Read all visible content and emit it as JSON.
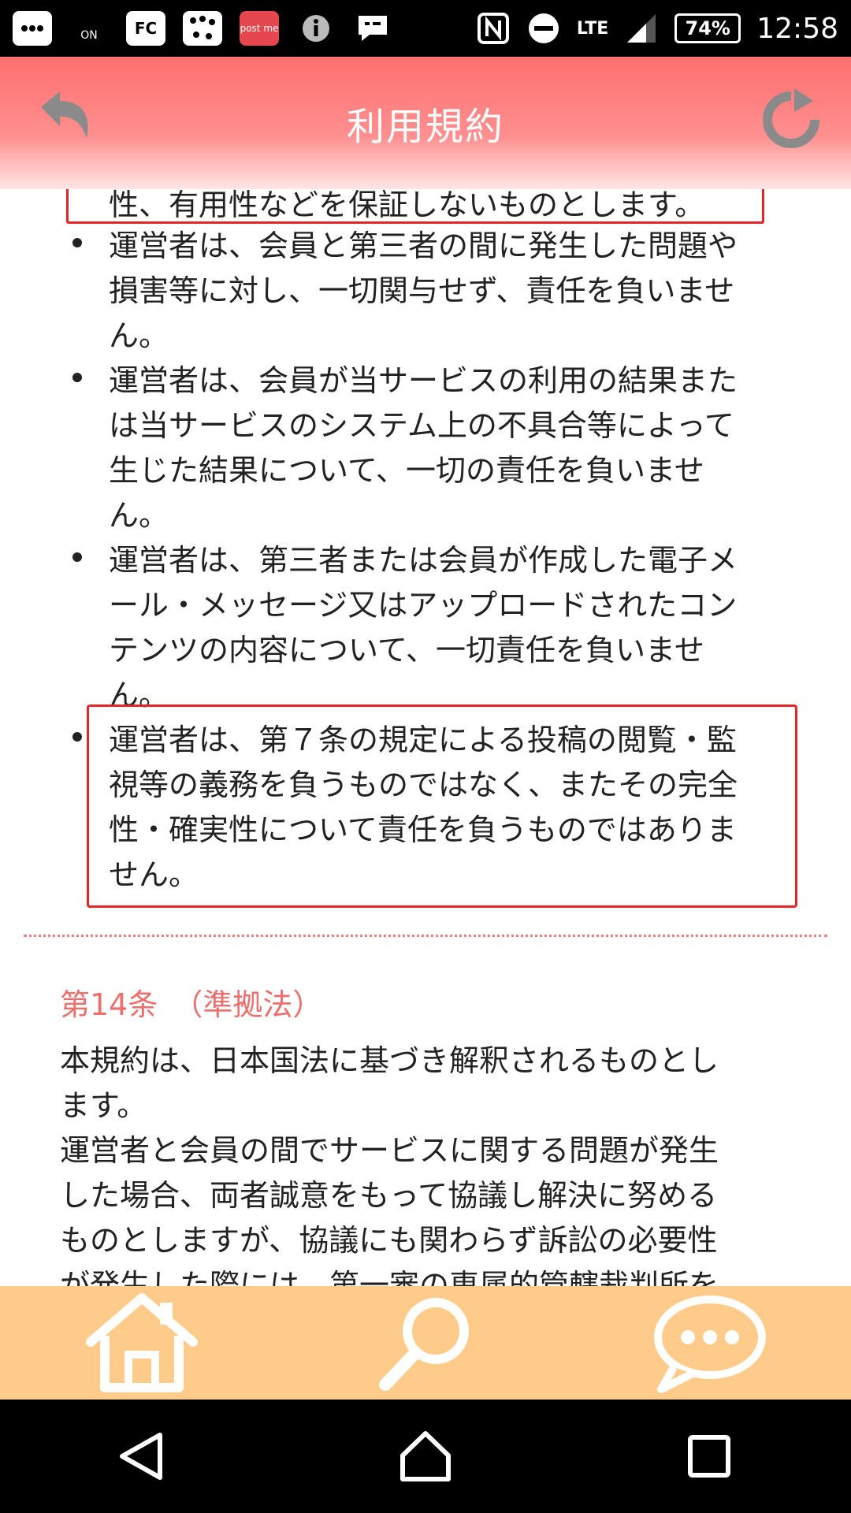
{
  "status_bar": {
    "icons": [
      {
        "name": "message-dots-icon",
        "label": ""
      },
      {
        "name": "wifi-call-icon",
        "label": "ON"
      },
      {
        "name": "fc-app-icon",
        "label": "FC"
      },
      {
        "name": "connect-app-icon",
        "label": ""
      },
      {
        "name": "postme-app-icon",
        "label": "post me"
      },
      {
        "name": "info-icon",
        "label": ""
      },
      {
        "name": "chat-bubble-icon",
        "label": ""
      }
    ],
    "network": "LTE",
    "battery": "74%",
    "clock": "12:58"
  },
  "header": {
    "title": "利用規約"
  },
  "content": {
    "top_fragment": "性、有用性などを保証しないものとします。",
    "bullets": [
      {
        "lines": [
          "運営者は、会員と第三者の間に発生した問題や",
          "損害等に対し、一切関与せず、責任を負いませ",
          "ん。"
        ]
      },
      {
        "lines": [
          "運営者は、会員が当サービスの利用の結果また",
          "は当サービスのシステム上の不具合等によって",
          "生じた結果について、一切の責任を負いませ",
          "ん。"
        ]
      },
      {
        "lines": [
          "運営者は、第三者または会員が作成した電子メ",
          "ール・メッセージ又はアップロードされたコン",
          "テンツの内容について、一切責任を負いませ",
          "ん。"
        ]
      },
      {
        "lines": [
          "運営者は、第７条の規定による投稿の閲覧・監",
          "視等の義務を負うものではなく、またその完全",
          "性・確実性について責任を負うものではありま",
          "せん。"
        ]
      }
    ],
    "article_14": {
      "heading": "第14条　（準拠法）",
      "lines": [
        "本規約は、日本国法に基づき解釈されるものとし",
        "ます。",
        "運営者と会員の間でサービスに関する問題が発生",
        "した場合、両者誠意をもって協議し解決に努める",
        "ものとしますが、協議にも関わらず訴訟の必要性",
        "が発生した際には、第一審の専属的管轄裁判所を"
      ]
    }
  },
  "bottom_nav": {
    "items": [
      {
        "name": "home-icon"
      },
      {
        "name": "search-icon"
      },
      {
        "name": "chat-icon"
      }
    ]
  },
  "colors": {
    "header_top": "#ff6f6f",
    "accent_red": "#e5252a",
    "heading_pink": "#ee6d6d",
    "nav_orange": "#ffcb8a"
  }
}
